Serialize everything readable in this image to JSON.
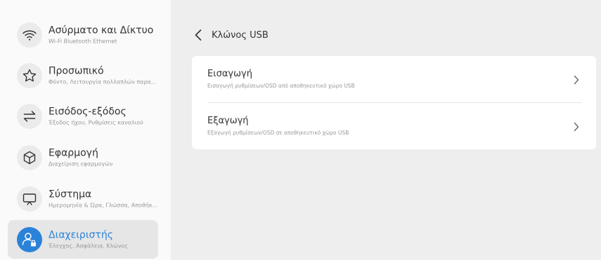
{
  "sidebar": {
    "items": [
      {
        "title": "Ασύρματο και Δίκτυο",
        "subtitle": "Wi-Fi Bluetooth Ethernet",
        "icon": "wifi-icon"
      },
      {
        "title": "Προσωπικό",
        "subtitle": "Φόντο, Λειτουργία πολλαπλών παρα...",
        "icon": "star-icon"
      },
      {
        "title": "Εισόδος-εξόδος",
        "subtitle": "Έξοδος ήχου, Ρυθμίσεις καναλιού",
        "icon": "arrows-swap-icon"
      },
      {
        "title": "Εφαρμογή",
        "subtitle": "Διαχείριση εφαρμογών",
        "icon": "cube-icon"
      },
      {
        "title": "Σύστημα",
        "subtitle": "Ημερομηνία & Ώρα, Γλώσσα, Αποθήκ...",
        "icon": "monitor-icon"
      },
      {
        "title": "Διαχειριστής",
        "subtitle": "Έλεγχος, Ασφάλεια, Κλώνος",
        "icon": "admin-user-lock-icon",
        "active": true
      }
    ]
  },
  "header": {
    "title": "Κλώνος USB"
  },
  "options": [
    {
      "title": "Εισαγωγή",
      "subtitle": "Εισαγωγή ρυθμίσεων/OSD από αποθηκευτικό χώρο USB"
    },
    {
      "title": "Εξαγωγή",
      "subtitle": "Εξαγωγή ρυθμίσεων/OSD σε αποθηκευτικό χώρο USB"
    }
  ],
  "colors": {
    "accent": "#2b82d9",
    "sidebar_bg": "#fafafa",
    "main_bg": "#eeeeee",
    "card_bg": "#ffffff"
  }
}
